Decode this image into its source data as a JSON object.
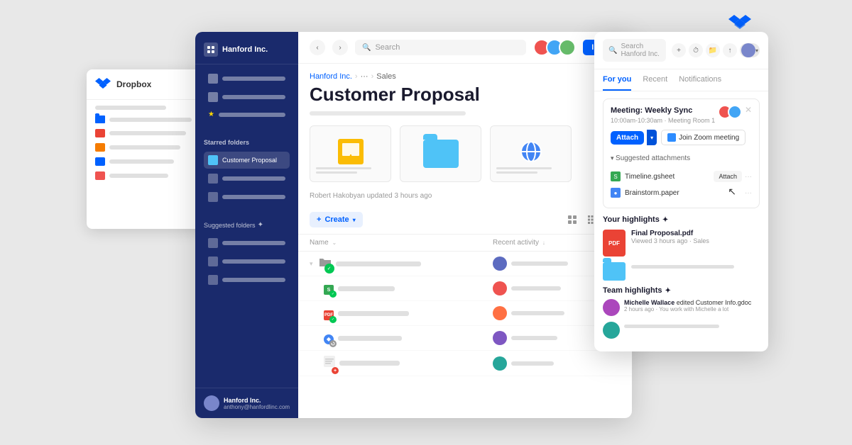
{
  "page": {
    "bg_color": "#e8e8e8"
  },
  "dropbox_bg_window": {
    "title": "Dropbox"
  },
  "main_window": {
    "company": "Hanford Inc.",
    "search_placeholder": "Search",
    "invite_label": "Invite",
    "breadcrumb": [
      "Hanford Inc.",
      "...",
      "Sales"
    ],
    "page_title": "Customer Proposal",
    "update_text": "Robert Hakobyan updated 3 hours ago",
    "create_label": "Create",
    "starred_folders_label": "Starred folders",
    "suggested_folders_label": "Suggested folders",
    "sidebar_user_name": "Hanford Inc.",
    "sidebar_user_email": "anthony@hanfordlinc.com",
    "file_list_header": {
      "name_col": "Name",
      "activity_col": "Recent activity"
    },
    "file_rows": [
      {
        "type": "folder",
        "badge": "check",
        "has_expand": true
      },
      {
        "type": "sheets",
        "badge": "sheets"
      },
      {
        "type": "pdf",
        "badge": "pdf"
      },
      {
        "type": "blue",
        "badge": "blue"
      },
      {
        "type": "multi",
        "badge": "red_plus"
      }
    ]
  },
  "right_panel": {
    "search_placeholder": "Search Hanford Inc.",
    "tabs": [
      "For you",
      "Recent",
      "Notifications"
    ],
    "active_tab": "For you",
    "meeting": {
      "title": "Meeting: Weekly Sync",
      "time": "10:00am-10:30am · Meeting Room 1",
      "attach_label": "Attach",
      "join_zoom_label": "Join Zoom meeting",
      "suggested_label": "Suggested attachments",
      "attachments": [
        {
          "name": "Timeline.gsheet",
          "type": "sheets"
        },
        {
          "name": "Brainstorm.paper",
          "type": "doc"
        }
      ],
      "attach_action_label": "Attach"
    },
    "highlights": {
      "title": "Your highlights",
      "items": [
        {
          "name": "Final Proposal.pdf",
          "meta": "Viewed 3 hours ago · Sales",
          "type": "pdf"
        },
        {
          "type": "folder"
        }
      ]
    },
    "team_highlights": {
      "title": "Team highlights",
      "items": [
        {
          "actor": "Michelle Wallace",
          "action": "edited Customer Info.gdoc",
          "meta": "2 hours ago · You work with Michelle a lot",
          "avatar_color": "#ab47bc"
        },
        {
          "actor": "",
          "action": "",
          "meta": "",
          "avatar_color": "#26a69a"
        }
      ]
    }
  }
}
